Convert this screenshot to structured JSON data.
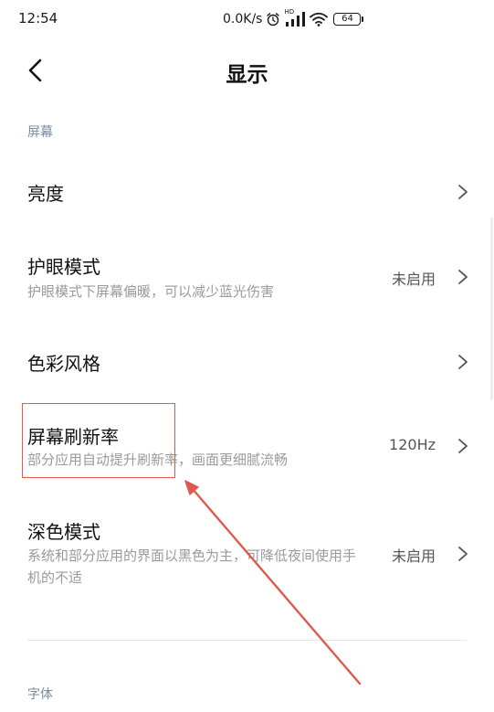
{
  "status_bar": {
    "time": "12:54",
    "net_speed": "0.0K/s",
    "signal_label": "HD",
    "battery": "64"
  },
  "header": {
    "title": "显示"
  },
  "sections": {
    "screen": "屏幕",
    "font": "字体"
  },
  "rows": [
    {
      "title": "亮度",
      "desc": "",
      "value": ""
    },
    {
      "title": "护眼模式",
      "desc": "护眼模式下屏幕偏暖，可以减少蓝光伤害",
      "value": "未启用"
    },
    {
      "title": "色彩风格",
      "desc": "",
      "value": ""
    },
    {
      "title": "屏幕刷新率",
      "desc": "部分应用自动提升刷新率，画面更细腻流畅",
      "value": "120Hz"
    },
    {
      "title": "深色模式",
      "desc": "系统和部分应用的界面以黑色为主，可降低夜间使用手机的不适",
      "value": "未启用"
    }
  ],
  "colors": {
    "section_label": "#7a8aa3",
    "annotation": "#e05a4c"
  },
  "icons": {
    "back": "chevron-left-icon",
    "row_arrow": "chevron-right-icon",
    "alarm": "alarm-clock-icon",
    "signal": "signal-icon",
    "wifi": "wifi-icon",
    "battery": "battery-icon"
  }
}
